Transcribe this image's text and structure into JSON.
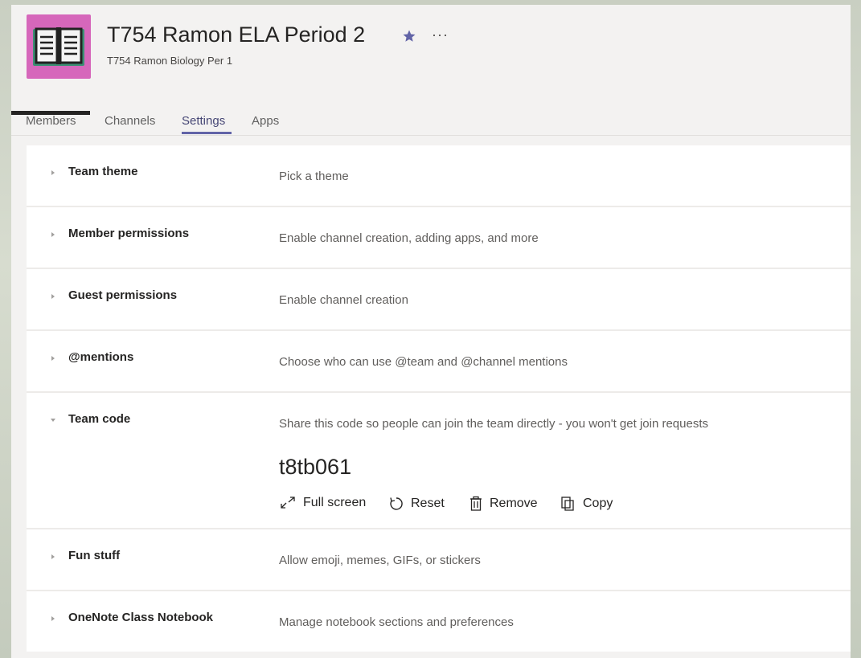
{
  "team": {
    "title": "T754 Ramon ELA Period 2",
    "subtitle": "T754 Ramon Biology Per 1",
    "avatar_color": "#d667bb",
    "avatar_icon": "book-icon",
    "favorite_icon": "star-icon",
    "favorite_color": "#6264a7",
    "more_label": "···"
  },
  "tabs": [
    {
      "label": "Members"
    },
    {
      "label": "Channels"
    },
    {
      "label": "Settings",
      "active": true
    },
    {
      "label": "Apps"
    }
  ],
  "settings": [
    {
      "title": "Team theme",
      "description": "Pick a theme"
    },
    {
      "title": "Member permissions",
      "description": "Enable channel creation, adding apps, and more"
    },
    {
      "title": "Guest permissions",
      "description": "Enable channel creation"
    },
    {
      "title": "@mentions",
      "description": "Choose who can use @team and @channel mentions"
    },
    {
      "title": "Team code",
      "description": "Share this code so people can join the team directly - you won't get join requests",
      "expanded": true
    },
    {
      "title": "Fun stuff",
      "description": "Allow emoji, memes, GIFs, or stickers"
    },
    {
      "title": "OneNote Class Notebook",
      "description": "Manage notebook sections and preferences"
    }
  ],
  "team_code": {
    "code": "t8tb061",
    "actions": [
      {
        "label": "Full screen",
        "icon": "expand-icon"
      },
      {
        "label": "Reset",
        "icon": "reset-icon"
      },
      {
        "label": "Remove",
        "icon": "trash-icon"
      },
      {
        "label": "Copy",
        "icon": "copy-icon"
      }
    ]
  },
  "colors": {
    "accent": "#6264a7",
    "text": "#252423",
    "secondary_text": "#605e5c"
  }
}
